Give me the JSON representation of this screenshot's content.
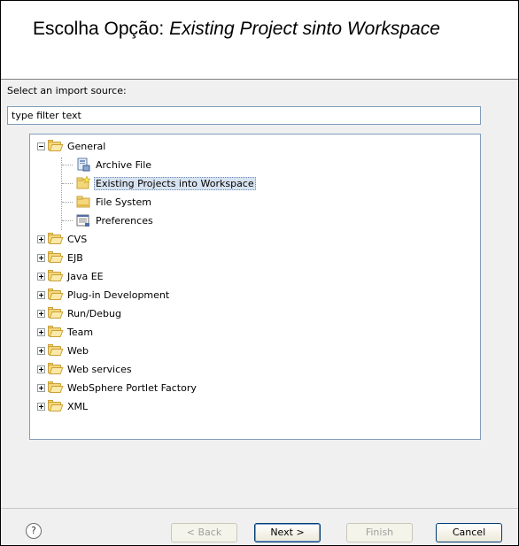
{
  "banner": {
    "prefix": "Escolha Opção: ",
    "italic": "Existing Project sinto Workspace"
  },
  "wizard": {
    "select_label": "Select an import source:",
    "filter_value": "type filter text"
  },
  "tree": {
    "general": "General",
    "children": [
      {
        "label": "Archive File",
        "icon": "archive-file-icon"
      },
      {
        "label": "Existing Projects into Workspace",
        "icon": "existing-projects-icon",
        "selected": true
      },
      {
        "label": "File System",
        "icon": "folder-icon"
      },
      {
        "label": "Preferences",
        "icon": "preferences-icon"
      }
    ],
    "categories": [
      "CVS",
      "EJB",
      "Java EE",
      "Plug-in Development",
      "Run/Debug",
      "Team",
      "Web",
      "Web services",
      "WebSphere Portlet Factory",
      "XML"
    ]
  },
  "footer": {
    "help": "?",
    "back": "< Back",
    "next": "Next >",
    "finish": "Finish",
    "cancel": "Cancel"
  },
  "colors": {
    "selection": "#d8e3f1",
    "folder": "#f3d77a",
    "border": "#7f9db9"
  }
}
